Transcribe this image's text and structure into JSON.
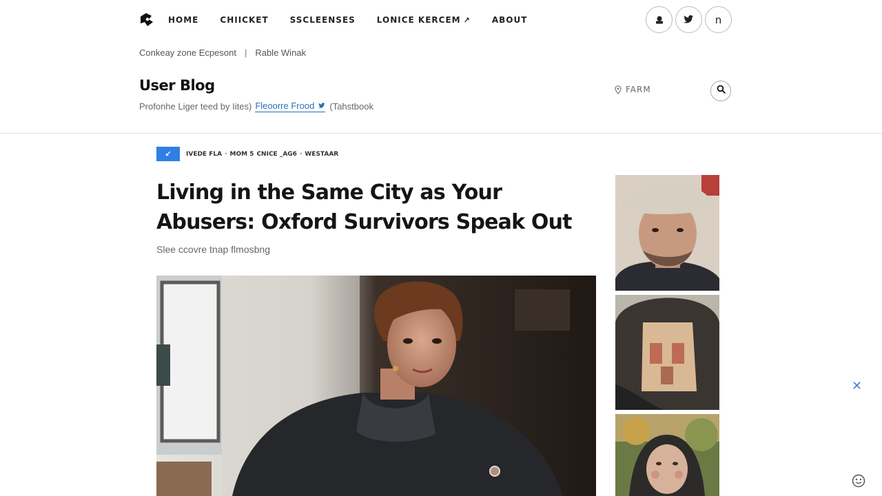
{
  "nav": {
    "items": [
      "HOME",
      "CHIICKET",
      "SSCLEENSES",
      "LONICE KERCEM",
      "ABOUT"
    ],
    "dropdown_arrow": "↗"
  },
  "social": {
    "icons": [
      "user-icon",
      "twitter-icon",
      "n-icon"
    ],
    "labels": [
      "",
      "",
      "n"
    ]
  },
  "sublinks": [
    "Conkeay zone Ecpesont",
    "Rable Winak"
  ],
  "sublinks_separator": "|",
  "blog": {
    "title": "User Blog",
    "meta_prefix": "Profonhe Liger teed by Iites)",
    "author": "Fleoorre Frood",
    "meta_suffix": "(Tahstbook"
  },
  "location": {
    "label": "FARM"
  },
  "crumbs": {
    "badge": "↙",
    "items": [
      "IVEDE FLA",
      "MOM 5",
      "CNICE _AG6",
      "WESTAAR"
    ]
  },
  "article": {
    "headline": "Living in the Same City as Your Abusers: Oxford Survivors Speak Out",
    "dek": "Slee ccovre tnap flmosbng"
  },
  "close_glyph": "✕",
  "colors": {
    "accent": "#2f7fe4",
    "author_link": "#2a6fb5",
    "divider": "#e0e0e0"
  }
}
